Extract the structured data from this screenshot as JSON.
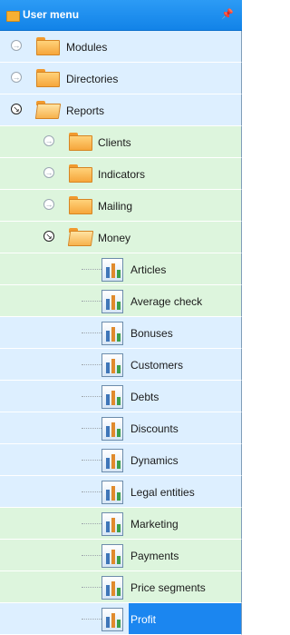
{
  "panel": {
    "title": "User menu",
    "pin_icon": "pin-icon"
  },
  "tree": {
    "level0": [
      {
        "label": "Modules",
        "state": "collapsed"
      },
      {
        "label": "Directories",
        "state": "collapsed"
      },
      {
        "label": "Reports",
        "state": "expanded"
      }
    ],
    "level1": [
      {
        "label": "Clients",
        "state": "collapsed"
      },
      {
        "label": "Indicators",
        "state": "collapsed"
      },
      {
        "label": "Mailing",
        "state": "collapsed"
      },
      {
        "label": "Money",
        "state": "expanded"
      }
    ],
    "reports": [
      {
        "label": "Articles"
      },
      {
        "label": "Average check"
      },
      {
        "label": "Bonuses"
      },
      {
        "label": "Customers"
      },
      {
        "label": "Debts"
      },
      {
        "label": "Discounts"
      },
      {
        "label": "Dynamics"
      },
      {
        "label": "Legal entities"
      },
      {
        "label": "Marketing"
      },
      {
        "label": "Payments"
      },
      {
        "label": "Price segments"
      },
      {
        "label": "Profit",
        "selected": true
      }
    ]
  },
  "colors": {
    "title_bar": "#1283e8",
    "row_blue": "#ddefff",
    "row_green": "#ddf5dd",
    "selection": "#1b86f0"
  }
}
